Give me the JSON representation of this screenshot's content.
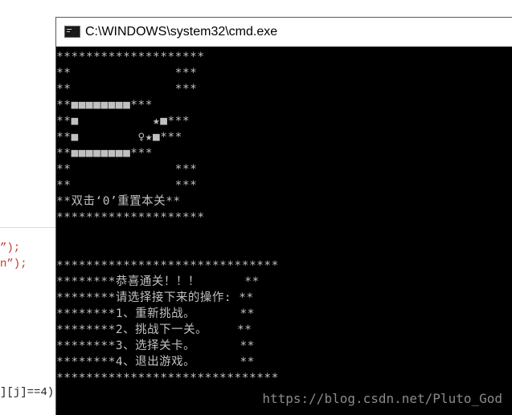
{
  "background_code": {
    "line1": "”);",
    "line2": "n”);",
    "line3": "][j]==4)"
  },
  "window": {
    "title": "C:\\WINDOWS\\system32\\cmd.exe",
    "icon": "cmd-icon"
  },
  "console": {
    "lines": [
      "********************",
      "**              ***",
      "**              ***",
      "**■■■■■■■■***",
      "**■          ★■***",
      "**■        ♀★■***",
      "**■■■■■■■■***",
      "**              ***",
      "**              ***",
      "**双击‘0’重置本关**",
      "********************",
      "",
      "",
      "******************************",
      "********恭喜通关！！！      **",
      "********请选择接下来的操作: **",
      "********1、重新挑战。      **",
      "********2、挑战下一关。    **",
      "********3、选择关卡。      **",
      "********4、退出游戏。      **",
      "******************************"
    ]
  },
  "watermark": "https://blog.csdn.net/Pluto_God",
  "colors": {
    "console_bg": "#000000",
    "console_fg": "#c0c0c0",
    "titlebar_bg": "#ffffff"
  }
}
